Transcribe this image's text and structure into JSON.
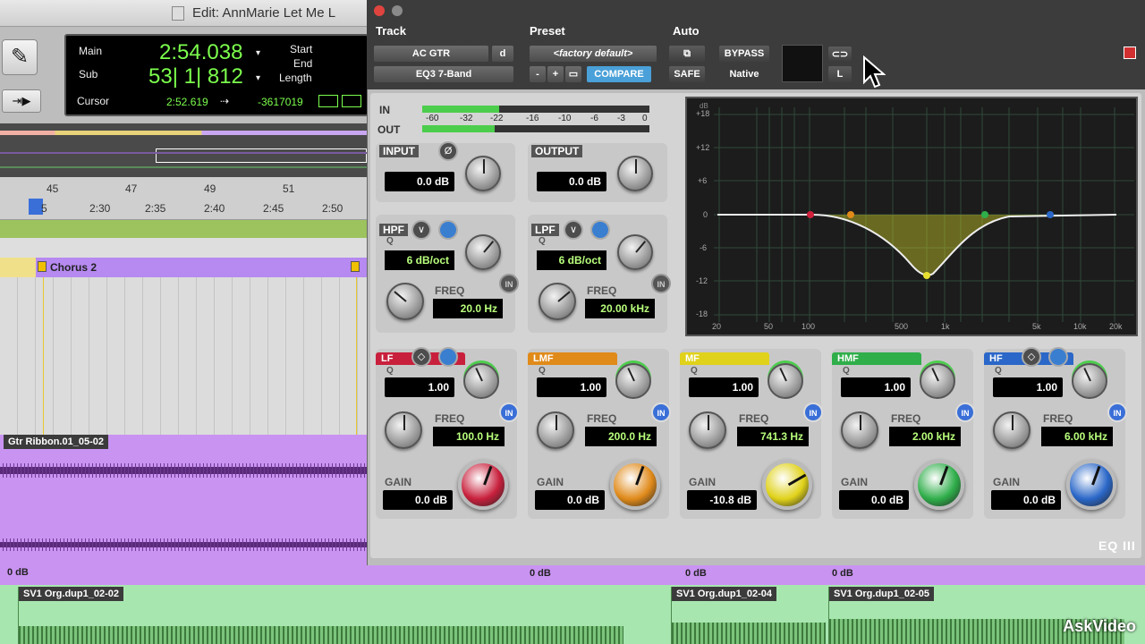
{
  "edit_window": {
    "title": "Edit: AnnMarie Let Me L",
    "counter": {
      "main_label": "Main",
      "main_value": "2:54.038",
      "sub_label": "Sub",
      "sub_value": "53| 1| 812",
      "start_label": "Start",
      "end_label": "End",
      "length_label": "Length",
      "cursor_label": "Cursor",
      "cursor_value": "2:52.619",
      "cursor_samples": "-3617019"
    },
    "ruler": {
      "bars": [
        "45",
        "47",
        "49",
        "51"
      ],
      "times": [
        "2:30",
        "2:35",
        "2:40",
        "2:45",
        "2:50"
      ],
      "partial_time": "5"
    },
    "marker": "Chorus 2",
    "clips": {
      "purple_clip": "Gtr Ribbon.01_05-02",
      "gain": "0 dB",
      "green_clips": [
        "SV1 Org.dup1_02-02",
        "SV1 Org.dup1_02-04",
        "SV1 Org.dup1_02-05"
      ]
    }
  },
  "plugin": {
    "header": {
      "track_label": "Track",
      "preset_label": "Preset",
      "auto_label": "Auto",
      "track_name": "AC GTR",
      "track_d": "d",
      "plugin_name": "EQ3 7-Band",
      "preset_name": "<factory default>",
      "minus": "-",
      "plus": "+",
      "compare": "COMPARE",
      "bypass": "BYPASS",
      "safe": "SAFE",
      "native": "Native",
      "channel": "L"
    },
    "meters": {
      "in_label": "IN",
      "out_label": "OUT",
      "scale": [
        "-60",
        "-32",
        "-22",
        "-16",
        "-10",
        "-6",
        "-3",
        "0"
      ]
    },
    "input": {
      "label": "INPUT",
      "value": "0.0 dB",
      "phase": "Ø"
    },
    "output": {
      "label": "OUTPUT",
      "value": "0.0 dB"
    },
    "hpf": {
      "label": "HPF",
      "q_label": "Q",
      "slope": "6 dB/oct",
      "freq_label": "FREQ",
      "freq": "20.0 Hz",
      "in": "IN"
    },
    "lpf": {
      "label": "LPF",
      "q_label": "Q",
      "slope": "6 dB/oct",
      "freq_label": "FREQ",
      "freq": "20.00 kHz",
      "in": "IN"
    },
    "bands": [
      {
        "name": "LF",
        "q_label": "Q",
        "q": "1.00",
        "freq_label": "FREQ",
        "freq": "100.0 Hz",
        "gain_label": "GAIN",
        "gain": "0.0 dB",
        "in": "IN",
        "color": "#c8203c"
      },
      {
        "name": "LMF",
        "q_label": "Q",
        "q": "1.00",
        "freq_label": "FREQ",
        "freq": "200.0 Hz",
        "gain_label": "GAIN",
        "gain": "0.0 dB",
        "in": "IN",
        "color": "#e08a1a"
      },
      {
        "name": "MF",
        "q_label": "Q",
        "q": "1.00",
        "freq_label": "FREQ",
        "freq": "741.3 Hz",
        "gain_label": "GAIN",
        "gain": "-10.8 dB",
        "in": "IN",
        "color": "#e0d21a"
      },
      {
        "name": "HMF",
        "q_label": "Q",
        "q": "1.00",
        "freq_label": "FREQ",
        "freq": "2.00 kHz",
        "gain_label": "GAIN",
        "gain": "0.0 dB",
        "in": "IN",
        "color": "#2fae4a"
      },
      {
        "name": "HF",
        "q_label": "Q",
        "q": "1.00",
        "freq_label": "FREQ",
        "freq": "6.00 kHz",
        "gain_label": "GAIN",
        "gain": "0.0 dB",
        "in": "IN",
        "color": "#2a67c8"
      }
    ],
    "graph": {
      "db_unit": "dB",
      "db_labels": [
        "+18",
        "+12",
        "+6",
        "0",
        "-6",
        "-12",
        "-18"
      ],
      "freq_labels": [
        "20",
        "50",
        "100",
        "500",
        "1k",
        "5k",
        "10k",
        "20k"
      ]
    },
    "logo": "EQ III"
  },
  "watermark": "AskVideo"
}
